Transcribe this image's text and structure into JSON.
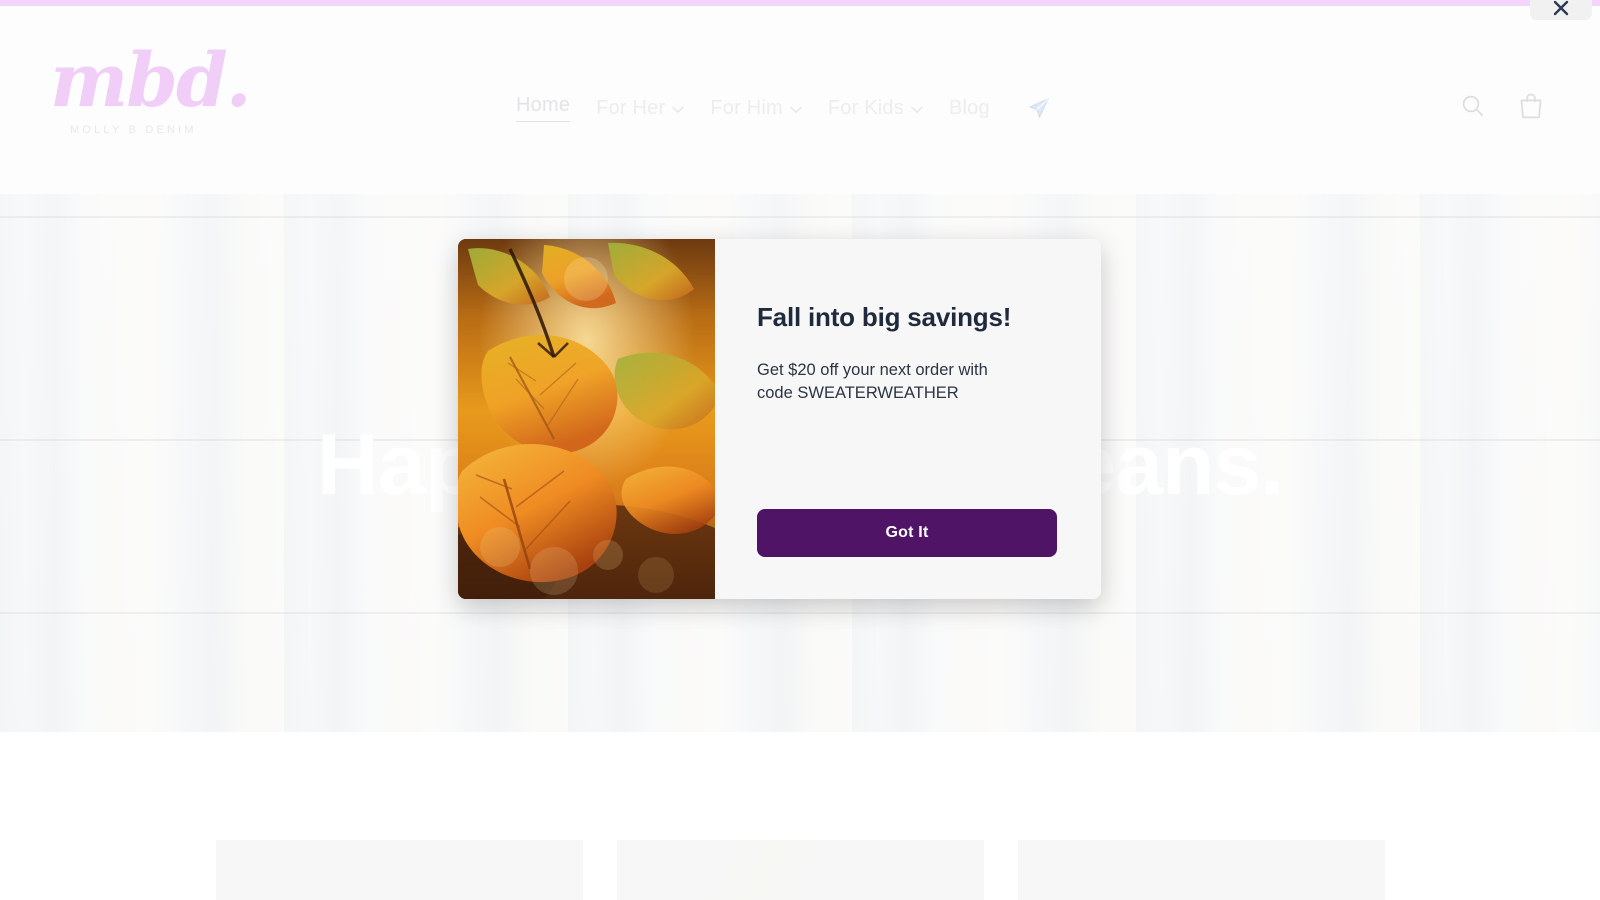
{
  "site": {
    "brand_mark": "mbd.",
    "brand_sub": "MOLLY B DENIM"
  },
  "header": {
    "nav": [
      {
        "label": "Home",
        "has_dropdown": false,
        "active": true
      },
      {
        "label": "For Her",
        "has_dropdown": true,
        "active": false
      },
      {
        "label": "For Him",
        "has_dropdown": true,
        "active": false
      },
      {
        "label": "For Kids",
        "has_dropdown": true,
        "active": false
      },
      {
        "label": "Blog",
        "has_dropdown": false,
        "active": false
      }
    ],
    "plane_icon": "paper-plane-icon",
    "search_icon": "search-icon",
    "cart_icon": "shopping-bag-icon"
  },
  "browser": {
    "close_icon": "close-icon"
  },
  "hero": {
    "title": "Happiness is new jeans.",
    "background_description": "washed-out photo of denim jeans hanging on a clothesline",
    "title_color": "#ffffff",
    "background_color": "#ece6d6"
  },
  "modal": {
    "heading": "Fall into big savings!",
    "body": "Get $20 off your next order with code SWEATERWEATHER",
    "cta_label": "Got It",
    "cta_color": "#4f1465",
    "image_description": "autumn maple leaves",
    "panel_color": "#f7f7f7"
  },
  "product_strip": {
    "cards": [
      {
        "name": "product-card-1"
      },
      {
        "name": "product-card-2"
      },
      {
        "name": "product-card-3"
      }
    ]
  },
  "theme": {
    "accent_bar": "#f3d4fb",
    "logo_pink": "#eec6f7",
    "heading_navy": "#1f2b3d"
  }
}
